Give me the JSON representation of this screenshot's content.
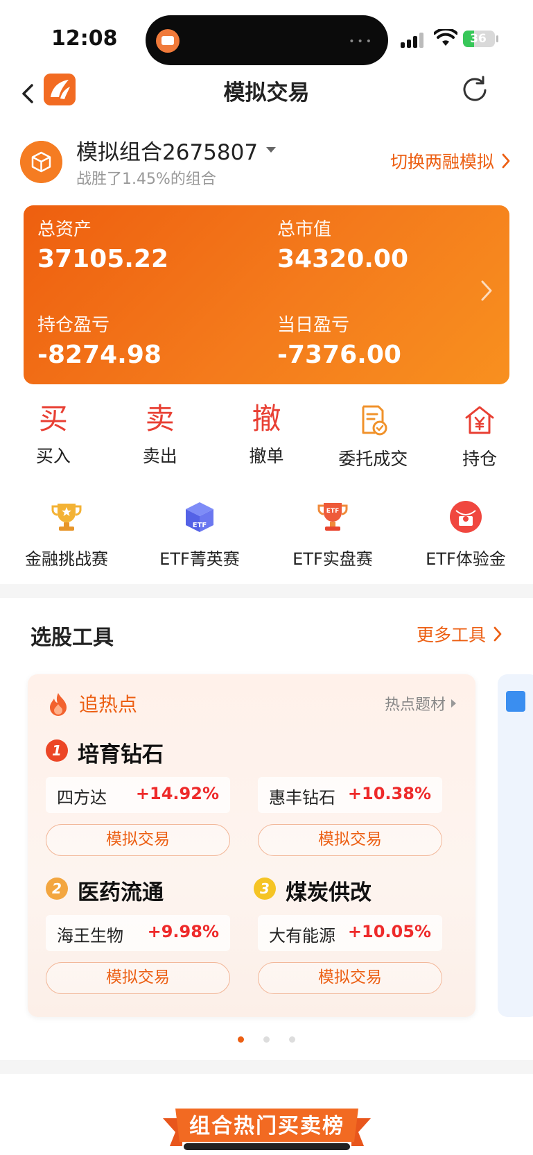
{
  "status_bar": {
    "time": "12:08",
    "battery": "36",
    "battery_level": 0.36
  },
  "nav": {
    "title": "模拟交易"
  },
  "portfolio": {
    "name": "模拟组合2675807",
    "subtitle": "战胜了1.45%的组合",
    "switch_label": "切换两融模拟"
  },
  "assets": {
    "total_assets_label": "总资产",
    "total_assets": "37105.22",
    "market_value_label": "总市值",
    "market_value": "34320.00",
    "position_pl_label": "持仓盈亏",
    "position_pl": "-8274.98",
    "daily_pl_label": "当日盈亏",
    "daily_pl": "-7376.00"
  },
  "actions": [
    {
      "glyph": "买",
      "label": "买入"
    },
    {
      "glyph": "卖",
      "label": "卖出"
    },
    {
      "glyph": "撤",
      "label": "撤单"
    },
    {
      "icon": "document-check-icon",
      "label": "委托成交"
    },
    {
      "icon": "house-yen-icon",
      "label": "持仓"
    }
  ],
  "competitions": [
    {
      "icon": "trophy-star-icon",
      "label": "金融挑战赛"
    },
    {
      "icon": "etf-cube-icon",
      "label": "ETF菁英赛"
    },
    {
      "icon": "etf-trophy-icon",
      "label": "ETF实盘赛"
    },
    {
      "icon": "red-envelope-icon",
      "label": "ETF体验金"
    }
  ],
  "tools": {
    "title": "选股工具",
    "more_label": "更多工具",
    "panel": {
      "title": "追热点",
      "link": "热点题材",
      "groups": [
        {
          "rank": "1",
          "name": "培育钻石",
          "stock": "四方达",
          "change": "+14.92%",
          "button": "模拟交易"
        },
        {
          "rank": "",
          "name": "",
          "stock": "惠丰钻石",
          "change": "+10.38%",
          "button": "模拟交易"
        },
        {
          "rank": "2",
          "name": "医药流通",
          "stock": "海王生物",
          "change": "+9.98%",
          "button": "模拟交易"
        },
        {
          "rank": "3",
          "name": "煤炭供改",
          "stock": "大有能源",
          "change": "+10.05%",
          "button": "模拟交易"
        }
      ]
    }
  },
  "ranking": {
    "title": "组合热门买卖榜"
  },
  "colors": {
    "accent": "#ec5f13",
    "up": "#ee2a2a",
    "card_start": "#ee5f0f",
    "card_end": "#f8901f"
  }
}
